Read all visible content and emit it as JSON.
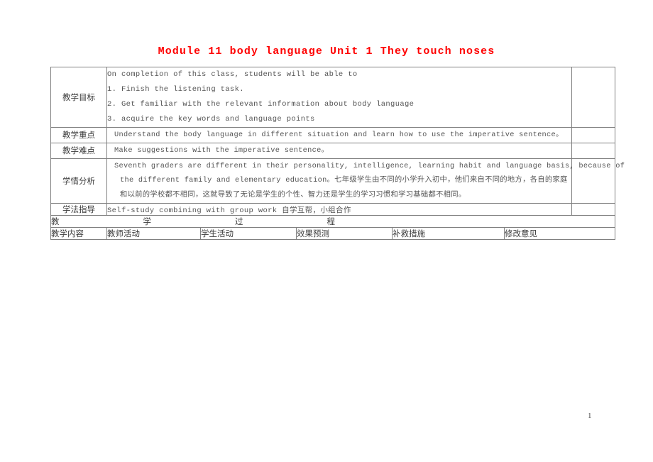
{
  "document": {
    "title": "Module 11 body language Unit 1 They touch noses",
    "title_color": "#ff0000",
    "page_number": "1"
  },
  "table": {
    "rows": [
      {
        "label": "教学目标",
        "lines": [
          "On completion of this class, students will be able to",
          "1. Finish the listening task.",
          "2. Get familiar with the relevant information about body language",
          "3. acquire the key words and language points"
        ]
      },
      {
        "label": "教学重点",
        "lines": [
          "Understand the body language in different situation and learn how to use the imperative sentence。"
        ]
      },
      {
        "label": "教学难点",
        "lines": [
          "Make suggestions with the imperative sentence。"
        ]
      },
      {
        "label": "学情分析",
        "lines": [
          "Seventh graders are different in their personality, intelligence, learning habit and language basis, because of",
          "the different family and elementary education。七年级学生由不同的小学升入初中，他们来自不同的地方，各自的家庭",
          "和以前的学校都不相同，这就导致了无论是学生的个性、智力还是学生的学习习惯和学习基础都不相同。"
        ]
      },
      {
        "label": "学法指导",
        "lines": [
          "Self-study combining with group work 自学互帮，小组合作"
        ]
      }
    ],
    "process_heading": {
      "chars": [
        "教",
        "学",
        "过",
        "程"
      ]
    },
    "column_headers": [
      "教学内容",
      "教师活动",
      "学生活动",
      "效果预测",
      "补救措施",
      "修改意见"
    ]
  }
}
